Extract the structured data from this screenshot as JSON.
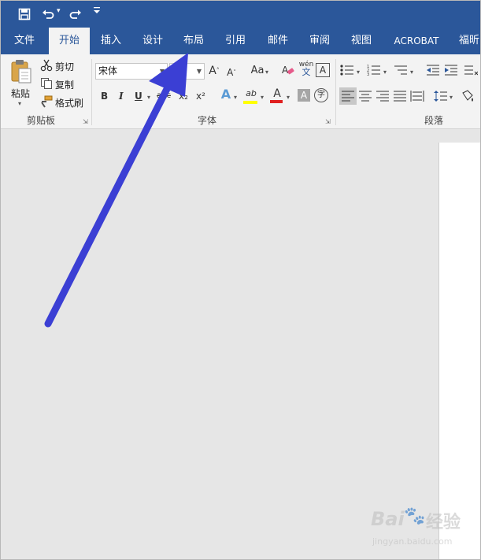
{
  "quick_access": {
    "save_icon": "save-icon",
    "undo_icon": "undo-icon",
    "redo_icon": "redo-icon",
    "customize_icon": "customize-qat-icon"
  },
  "tabs": [
    "文件",
    "开始",
    "插入",
    "设计",
    "布局",
    "引用",
    "邮件",
    "审阅",
    "视图",
    "ACROBAT",
    "福昕"
  ],
  "active_tab": "开始",
  "clipboard": {
    "paste_label": "粘贴",
    "cut_label": "剪切",
    "copy_label": "复制",
    "format_painter_label": "格式刷",
    "group_label": "剪贴板"
  },
  "font": {
    "font_name": "宋体",
    "font_size": "",
    "grow_label": "A",
    "shrink_label": "A",
    "case_label": "Aa",
    "phonetic_top": "wén",
    "phonetic_bottom": "文",
    "border_label": "A",
    "bold": "B",
    "italic": "I",
    "underline": "U",
    "strike": "abc",
    "subscript": "x₂",
    "superscript": "x²",
    "effects_label": "A",
    "highlight_label": "ab",
    "font_color_label": "A",
    "shading_label": "A",
    "enclose_label": "字",
    "group_label": "字体"
  },
  "paragraph": {
    "group_label": "段落"
  },
  "watermark": {
    "brand": "Bai",
    "brand2": "经验",
    "url": "jingyan.baidu.com"
  },
  "colors": {
    "ribbon_blue": "#2b579a",
    "arrow": "#3b3fd4",
    "font_color_bar": "#e02020",
    "highlight_bar": "#ffff00"
  }
}
